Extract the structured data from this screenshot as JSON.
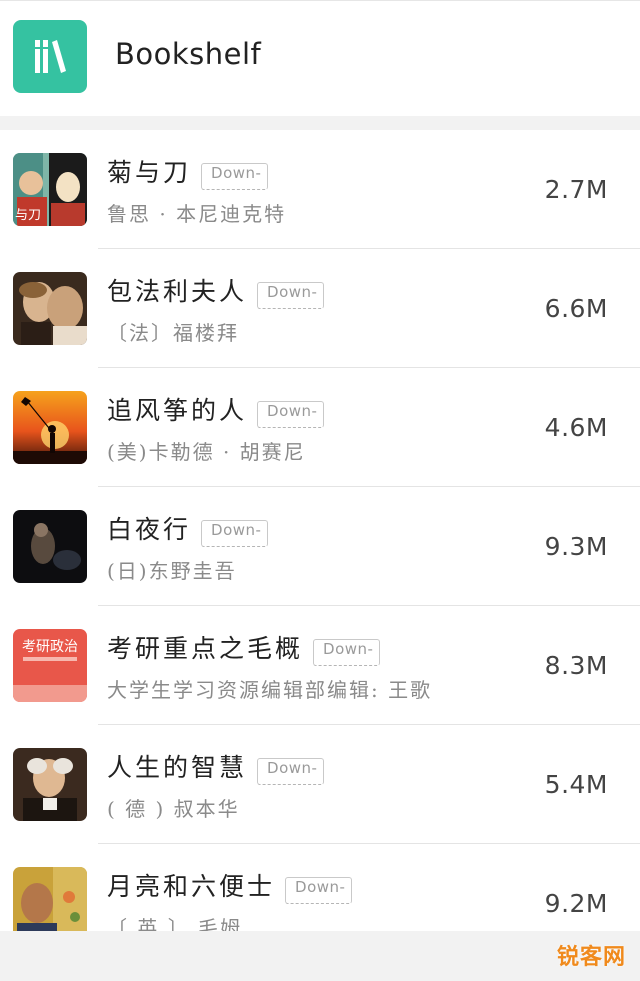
{
  "header": {
    "title": "Bookshelf",
    "logo_icon": "bookshelf-logo-icon",
    "logo_color": "#35c2a1"
  },
  "books": [
    {
      "title": "菊与刀",
      "author": "鲁思 · 本尼迪克特",
      "size": "2.7M",
      "badge": "Down-",
      "cover_icon": "cover-art-japanese-portrait"
    },
    {
      "title": "包法利夫人",
      "author": "〔法〕福楼拜",
      "size": "6.6M",
      "badge": "Down-",
      "cover_icon": "cover-art-couple-embrace"
    },
    {
      "title": "追风筝的人",
      "author": "(美)卡勒德 · 胡赛尼",
      "size": "4.6M",
      "badge": "Down-",
      "cover_icon": "cover-art-kite-sunset"
    },
    {
      "title": "白夜行",
      "author": "(日)东野圭吾",
      "size": "9.3M",
      "badge": "Down-",
      "cover_icon": "cover-art-dark-figure"
    },
    {
      "title": "考研重点之毛概",
      "author": "大学生学习资源编辑部编辑: 王歌",
      "size": "8.3M",
      "badge": "Down-",
      "cover_icon": "cover-art-red-label"
    },
    {
      "title": "人生的智慧",
      "author": "( 德 ) 叔本华",
      "size": "5.4M",
      "badge": "Down-",
      "cover_icon": "cover-art-philosopher-portrait"
    },
    {
      "title": "月亮和六便士",
      "author": "〔 英 〕 毛姆",
      "size": "9.2M",
      "badge": "Down-",
      "cover_icon": "cover-art-gauguin-painting"
    }
  ],
  "covers": {
    "red_label_text": "考研政治"
  },
  "watermark": {
    "brand": "锐客网"
  }
}
